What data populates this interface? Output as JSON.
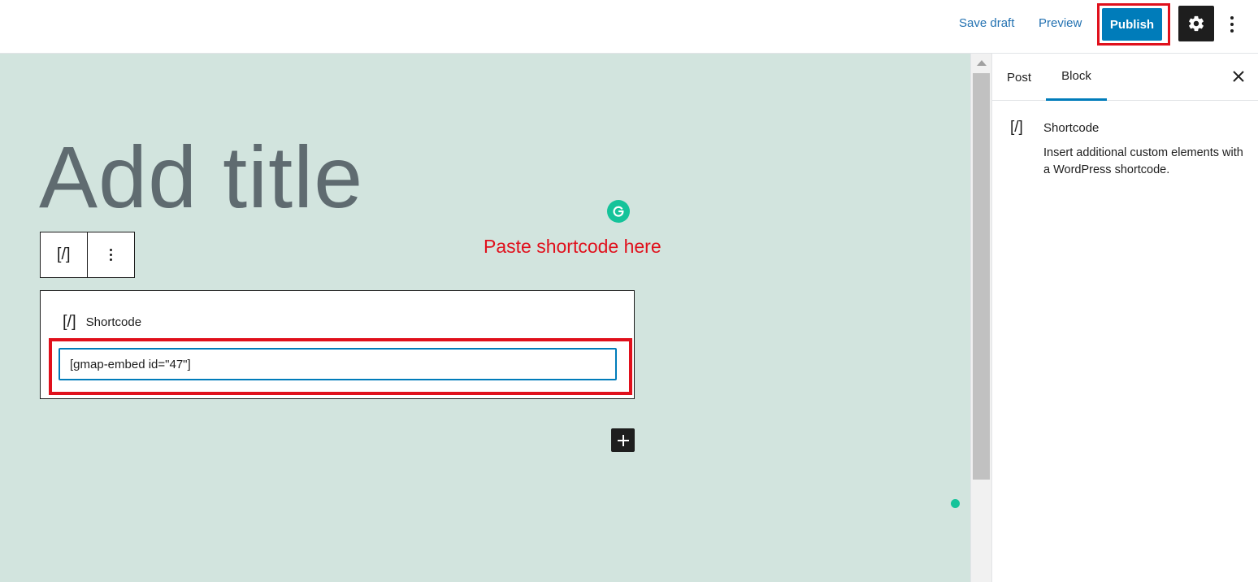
{
  "header": {
    "save_draft_label": "Save draft",
    "preview_label": "Preview",
    "publish_label": "Publish",
    "settings_icon": "gear-icon",
    "more_icon": "vertical-ellipsis-icon"
  },
  "editor": {
    "title_placeholder": "Add title",
    "block_toolbar": {
      "block_icon_glyph": "[/]",
      "options_icon": "vertical-ellipsis-icon"
    },
    "shortcode_block": {
      "icon_glyph": "[/]",
      "label": "Shortcode",
      "input_value": "[gmap-embed id=\"47\"]"
    },
    "annotation_text": "Paste shortcode here",
    "add_block_icon": "plus-icon"
  },
  "sidebar": {
    "tabs": [
      {
        "label": "Post"
      },
      {
        "label": "Block"
      }
    ],
    "close_icon": "close-icon",
    "block_card": {
      "icon_glyph": "[/]",
      "title": "Shortcode",
      "description": "Insert additional custom elements with a WordPress shortcode."
    }
  },
  "colors": {
    "accent": "#007cba",
    "annotation_red": "#e0101c",
    "canvas_background": "#d2e4de",
    "grammarly_green": "#15c39a"
  }
}
